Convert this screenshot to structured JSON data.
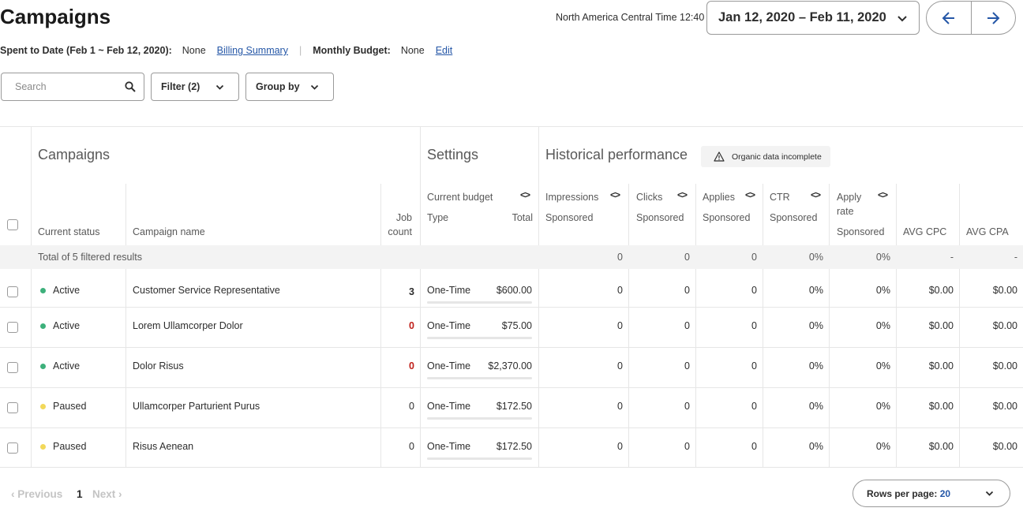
{
  "header": {
    "title": "Campaigns",
    "timezone": "North America Central Time 12:40",
    "date_range": "Jan 12, 2020 – Feb 11, 2020"
  },
  "spent": {
    "label": "Spent to Date (Feb 1 ~ Feb 12, 2020):",
    "value": "None",
    "billing_link": "Billing Summary",
    "budget_label": "Monthly Budget:",
    "budget_value": "None",
    "edit_link": "Edit"
  },
  "toolbar": {
    "search_placeholder": "Search",
    "filter_label": "Filter (2)",
    "groupby_label": "Group by"
  },
  "groups": {
    "campaigns": "Campaigns",
    "settings": "Settings",
    "historical": "Historical performance",
    "organic_notice": "Organic data incomplete"
  },
  "columns": {
    "status": "Current status",
    "name": "Campaign name",
    "job_count_1": "Job",
    "job_count_2": "count",
    "current_budget": "Current budget",
    "type": "Type",
    "total": "Total",
    "impressions": "Impressions",
    "clicks": "Clicks",
    "applies": "Applies",
    "ctr": "CTR",
    "apply_rate_1": "Apply",
    "apply_rate_2": "rate",
    "sponsored": "Sponsored",
    "avg_cpc": "AVG CPC",
    "avg_cpa": "AVG CPA"
  },
  "total_row": {
    "label": "Total of 5 filtered results",
    "impressions": "0",
    "clicks": "0",
    "applies": "0",
    "ctr": "0%",
    "apply_rate": "0%",
    "avg_cpc": "-",
    "avg_cpa": "-"
  },
  "rows": [
    {
      "status": "Active",
      "name": "Customer Service Representative",
      "job_count": "3",
      "type": "One-Time",
      "total": "$600.00",
      "impressions": "0",
      "clicks": "0",
      "applies": "0",
      "ctr": "0%",
      "apply_rate": "0%",
      "avg_cpc": "$0.00",
      "avg_cpa": "$0.00"
    },
    {
      "status": "Active",
      "name": "Lorem Ullamcorper Dolor",
      "job_count": "0",
      "type": "One-Time",
      "total": "$75.00",
      "impressions": "0",
      "clicks": "0",
      "applies": "0",
      "ctr": "0%",
      "apply_rate": "0%",
      "avg_cpc": "$0.00",
      "avg_cpa": "$0.00"
    },
    {
      "status": "Active",
      "name": "Dolor Risus",
      "job_count": "0",
      "type": "One-Time",
      "total": "$2,370.00",
      "impressions": "0",
      "clicks": "0",
      "applies": "0",
      "ctr": "0%",
      "apply_rate": "0%",
      "avg_cpc": "$0.00",
      "avg_cpa": "$0.00"
    },
    {
      "status": "Paused",
      "name": "Ullamcorper Parturient Purus",
      "job_count": "0",
      "type": "One-Time",
      "total": "$172.50",
      "impressions": "0",
      "clicks": "0",
      "applies": "0",
      "ctr": "0%",
      "apply_rate": "0%",
      "avg_cpc": "$0.00",
      "avg_cpa": "$0.00"
    },
    {
      "status": "Paused",
      "name": "Risus Aenean",
      "job_count": "0",
      "type": "One-Time",
      "total": "$172.50",
      "impressions": "0",
      "clicks": "0",
      "applies": "0",
      "ctr": "0%",
      "apply_rate": "0%",
      "avg_cpc": "$0.00",
      "avg_cpa": "$0.00"
    }
  ],
  "pagination": {
    "previous": "Previous",
    "page": "1",
    "next": "Next",
    "rows_per_page_label": "Rows per page:",
    "rows_per_page_value": "20"
  },
  "colors": {
    "active": "#3db07b",
    "paused": "#f2d85a",
    "zero_jobs": "#c0201a",
    "link": "#2557a7"
  }
}
